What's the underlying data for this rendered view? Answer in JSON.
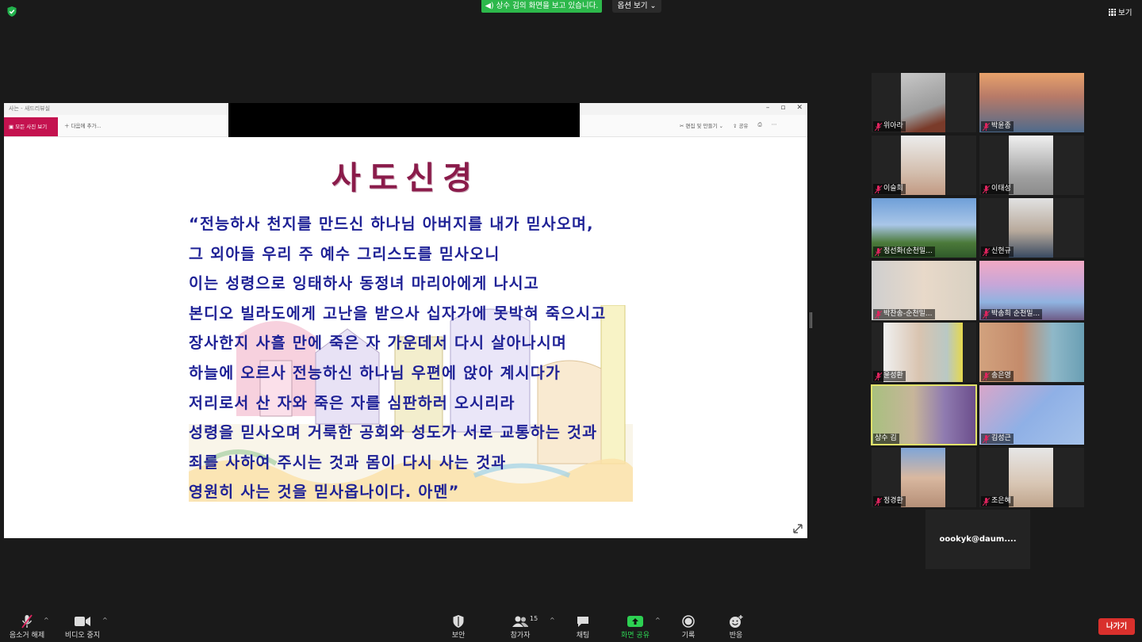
{
  "top": {
    "share_banner": "상수 김의 화면을 보고 있습니다.",
    "view_options": "옵션 보기",
    "view": "보기"
  },
  "shared_screen": {
    "window_title": "사는 - 새드리뷰실",
    "toolbar_primary": "모든 사진 보기",
    "toolbar_add": "다음에 추가...",
    "toolbar_edit": "편집 및 만들기",
    "toolbar_share": "공유",
    "slide": {
      "title": "사도신경",
      "lines": [
        "“전능하사 천지를 만드신 하나님 아버지를 내가 믿사오며,",
        "그 외아들 우리 주 예수 그리스도를 믿사오니",
        "이는 성령으로 잉태하사 동정녀 마리아에게 나시고",
        "본디오 빌라도에게 고난을 받으사 십자가에 못박혀 죽으시고",
        "장사한지 사흘 만에 죽은 자 가운데서 다시 살아나시며",
        "하늘에 오르사 전능하신 하나님 우편에 앉아 계시다가",
        "저리로서 산 자와 죽은 자를 심판하러 오시리라",
        "성령을 믿사오며 거룩한 공회와 성도가 서로 교통하는 것과",
        "죄를 사하여 주시는 것과 몸이 다시 사는 것과",
        "영원히 사는 것을 믿사옵나이다. 아멘”"
      ]
    }
  },
  "participants": [
    {
      "name": "위아라",
      "muted": true
    },
    {
      "name": "박윤종",
      "muted": true
    },
    {
      "name": "이슬희",
      "muted": true
    },
    {
      "name": "이태성",
      "muted": true
    },
    {
      "name": "정선화(순천밀...",
      "muted": true
    },
    {
      "name": "신현규",
      "muted": true
    },
    {
      "name": "박찬송-순천밀...",
      "muted": true
    },
    {
      "name": "박송희 순천밀...",
      "muted": true
    },
    {
      "name": "윤성환",
      "muted": true
    },
    {
      "name": "송은영",
      "muted": true
    },
    {
      "name": "상수 김",
      "muted": false
    },
    {
      "name": "김성근",
      "muted": true
    },
    {
      "name": "정경환",
      "muted": true
    },
    {
      "name": "조은혜",
      "muted": true
    }
  ],
  "email_tile": "oookyk@daum....",
  "controls": {
    "mute": "음소거 해제",
    "video": "비디오 중지",
    "security": "보안",
    "participants": "참가자",
    "participants_count": "15",
    "chat": "채팅",
    "share": "화면 공유",
    "record": "기록",
    "reactions": "반응",
    "leave": "나가기"
  },
  "colors": {
    "accent_green": "#2db84b",
    "leave_red": "#d9302c",
    "slide_title": "#8a1b4a",
    "slide_text": "#1f2296",
    "active_speaker": "#e2e26a"
  }
}
